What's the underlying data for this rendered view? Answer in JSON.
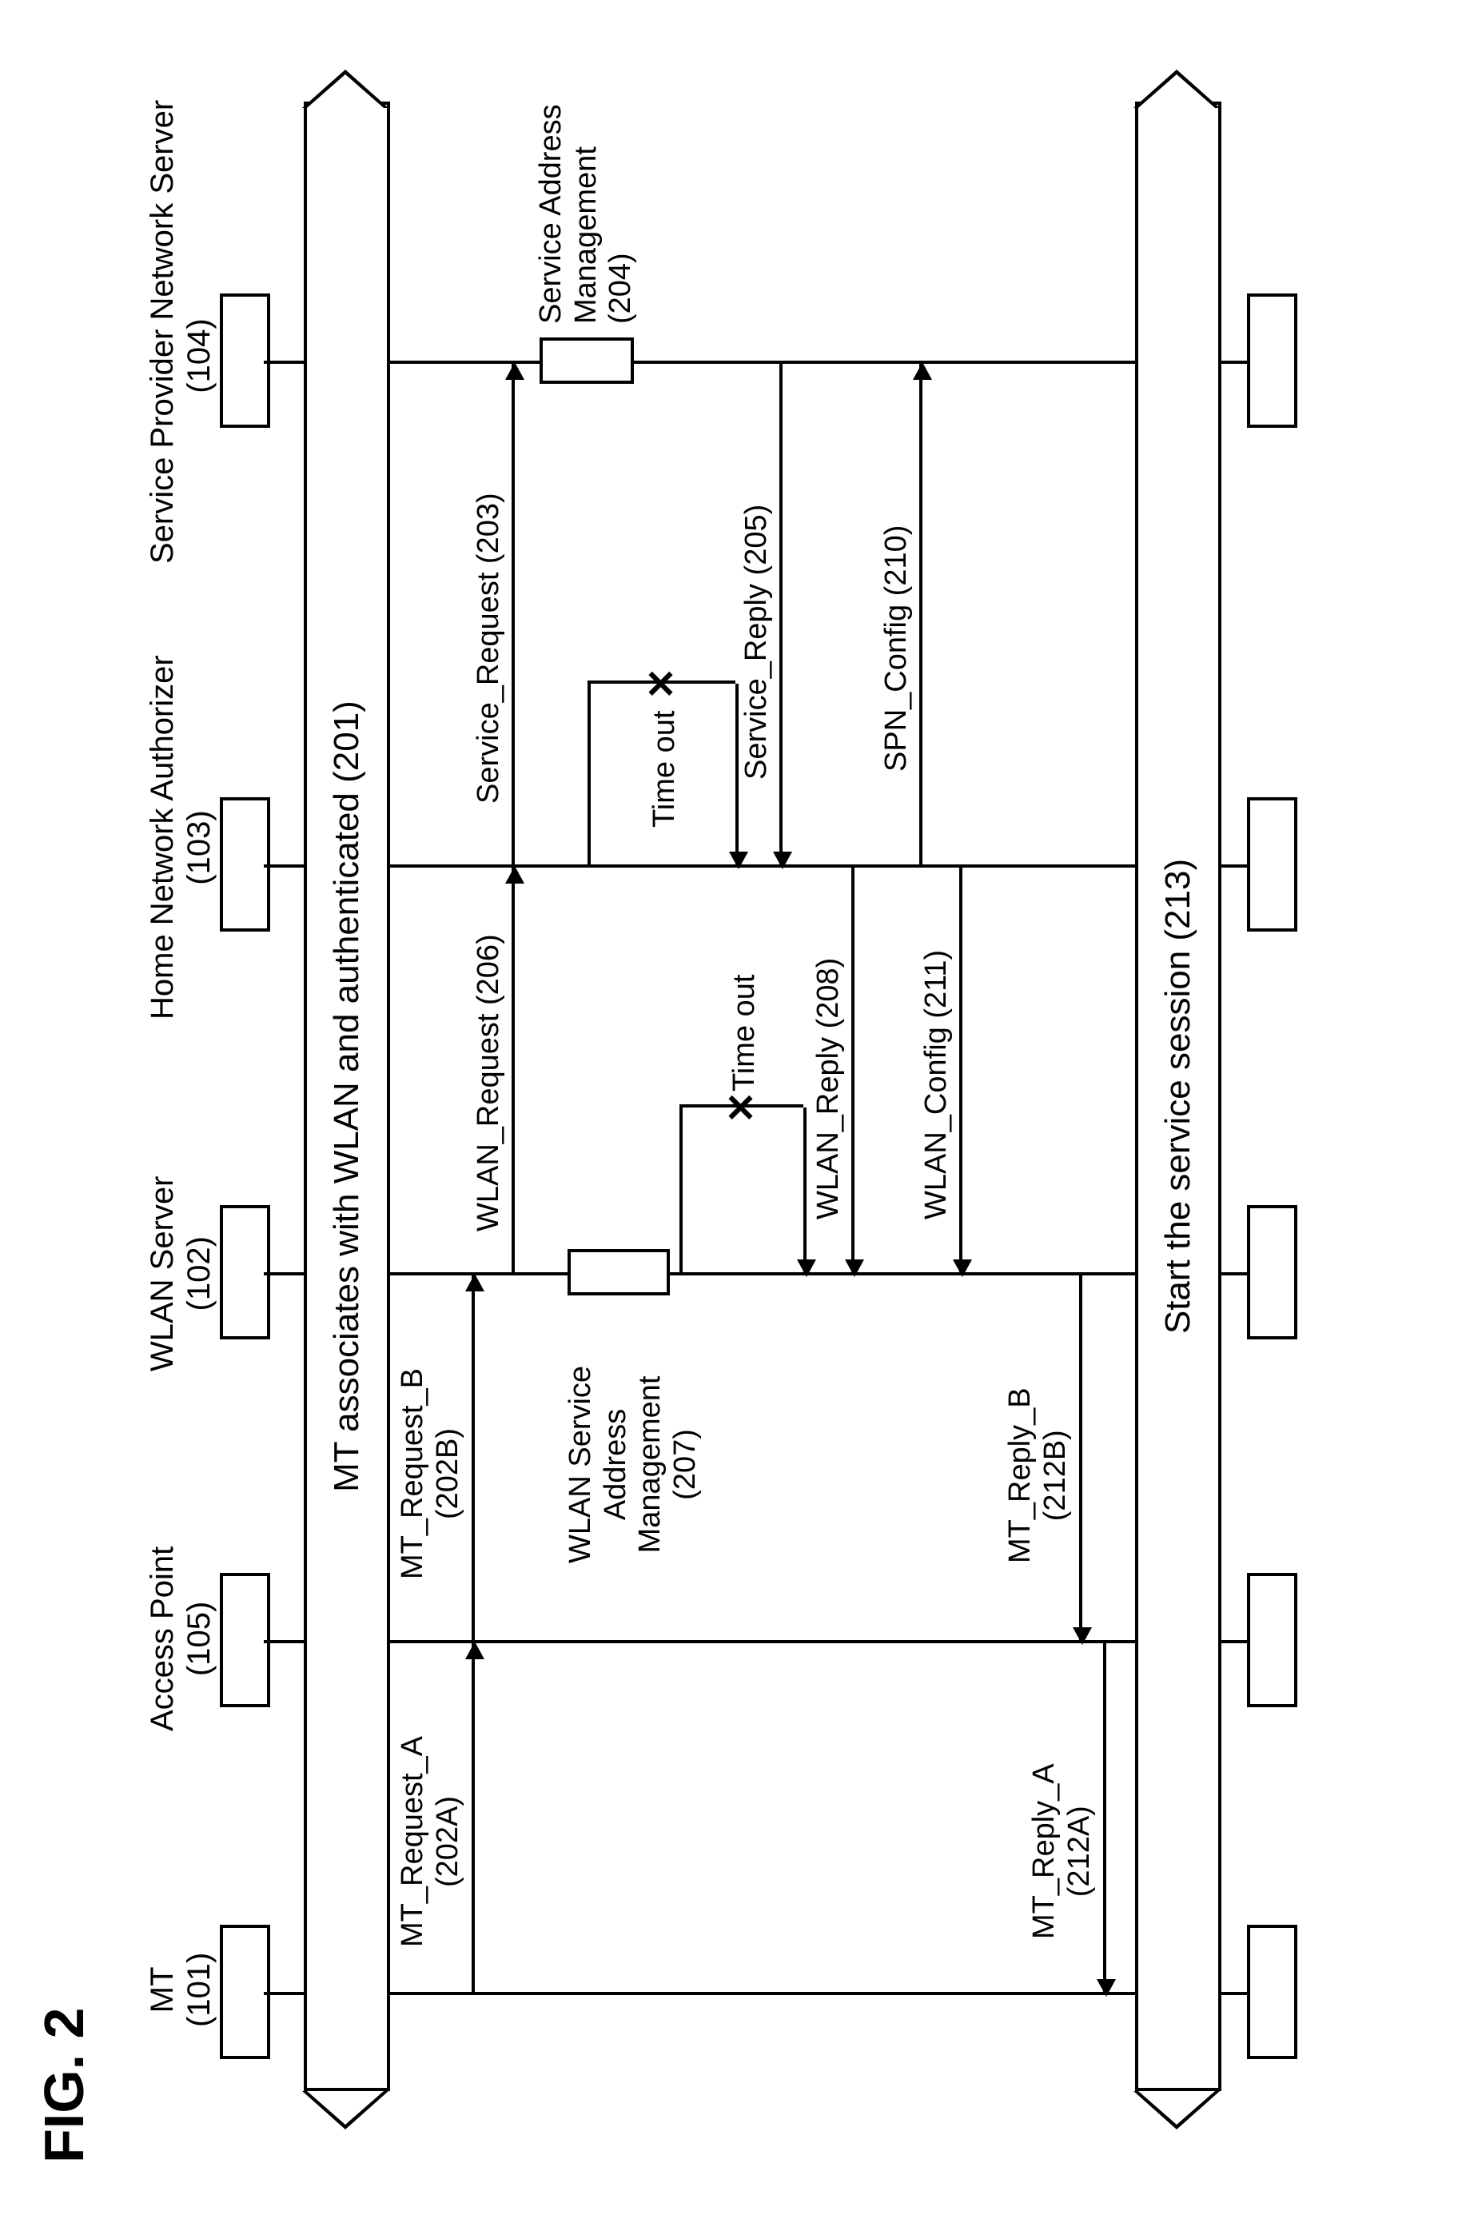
{
  "figure_label": "FIG. 2",
  "actors": {
    "mt": {
      "name": "MT",
      "id": "(101)"
    },
    "ap": {
      "name": "Access Point",
      "id": "(105)"
    },
    "wlan": {
      "name": "WLAN Server",
      "id": "(102)"
    },
    "hna": {
      "name": "Home Network Authorizer",
      "id": "(103)"
    },
    "spn": {
      "name": "Service Provider Network Server",
      "id": "(104)"
    }
  },
  "banners": {
    "top": "MT associates with WLAN and authenticated (201)",
    "bottom": "Start the service session (213)"
  },
  "messages": {
    "mt_req_a": "MT_Request_A\n(202A)",
    "mt_req_b": "MT_Request_B\n(202B)",
    "wlan_req": "WLAN_Request (206)",
    "svc_req": "Service_Request (203)",
    "svc_addr": "Service Address\nManagement\n(204)",
    "svc_reply": "Service_Reply (205)",
    "wlan_svc_addr": "WLAN Service\nAddress\nManagement\n(207)",
    "wlan_reply": "WLAN_Reply (208)",
    "spn_cfg": "SPN_Config (210)",
    "wlan_cfg": "WLAN_Config (211)",
    "mt_rep_a": "MT_Reply_A\n(212A)",
    "mt_rep_b": "MT_Reply_B\n(212B)",
    "timeout1": "Time out",
    "timeout2": "Time out"
  }
}
